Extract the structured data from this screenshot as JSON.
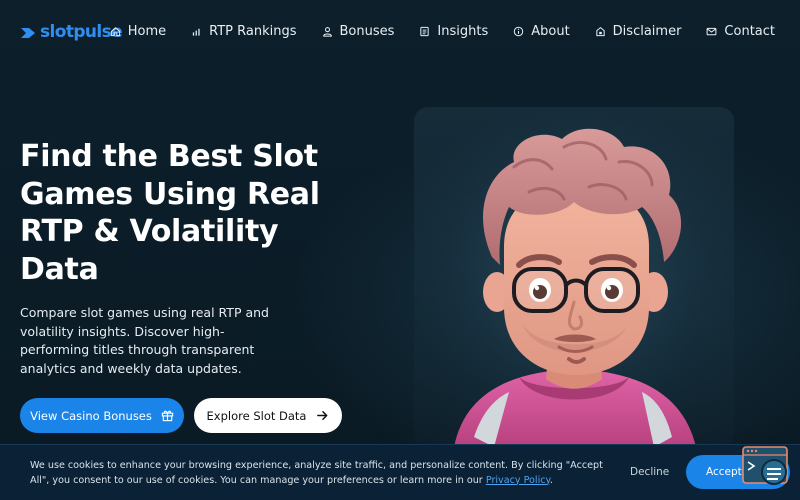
{
  "brand": {
    "name": "slotpulse",
    "color": "#2f8ff0"
  },
  "nav": {
    "items": [
      {
        "label": "Home",
        "icon": "home-icon"
      },
      {
        "label": "RTP Rankings",
        "icon": "bar-chart-icon"
      },
      {
        "label": "Bonuses",
        "icon": "user-icon"
      },
      {
        "label": "Insights",
        "icon": "document-icon"
      },
      {
        "label": "About",
        "icon": "info-icon"
      },
      {
        "label": "Disclaimer",
        "icon": "lock-icon"
      },
      {
        "label": "Contact",
        "icon": "mail-icon"
      }
    ]
  },
  "hero": {
    "title": "Find the Best Slot Games Using Real RTP & Volatility Data",
    "description": "Compare slot games using real RTP and volatility insights. Discover high-performing titles through transparent analytics and weekly data updates.",
    "primary_button": {
      "label": "View Casino Bonuses",
      "icon": "gift-icon"
    },
    "secondary_button": {
      "label": "Explore Slot Data",
      "icon": "arrow-right-icon"
    }
  },
  "cookie": {
    "text": "We use cookies to enhance your browsing experience, analyze site traffic, and personalize content. By clicking \"Accept All\", you consent to our use of cookies. You can manage your preferences or learn more in our",
    "link": "Privacy Policy",
    "period": ".",
    "decline": "Decline",
    "accept": "Accept All"
  },
  "colors": {
    "background": "#0b1c27",
    "accent": "#1a84e8",
    "cookie_bar": "#0b2236"
  }
}
